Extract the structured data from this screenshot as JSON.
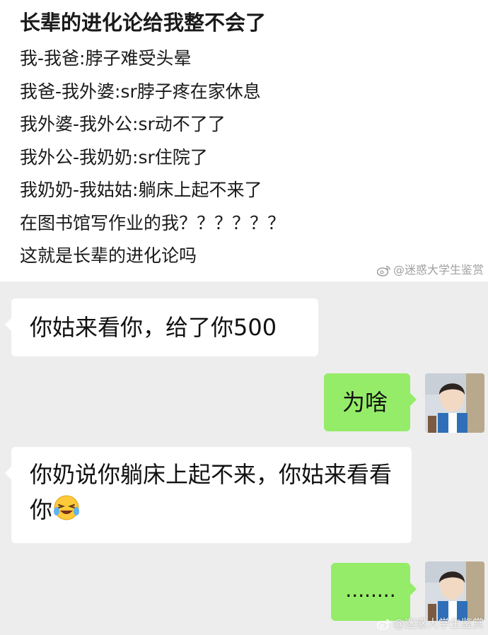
{
  "post": {
    "title": "长辈的进化论给我整不会了",
    "lines": [
      "我-我爸:脖子难受头晕",
      "我爸-我外婆:sr脖子疼在家休息",
      "我外婆-我外公:sr动不了了",
      "我外公-我奶奶:sr住院了",
      "我奶奶-我姑姑:躺床上起不来了",
      "在图书馆写作业的我？？？？？？",
      "这就是长辈的进化论吗"
    ]
  },
  "watermark": {
    "text": "@迷惑大学生鉴赏"
  },
  "chat": {
    "messages": [
      {
        "side": "in",
        "text": "你姑来看你，给了你500"
      },
      {
        "side": "out",
        "text": "为啥"
      },
      {
        "side": "in",
        "text": "你奶说你躺床上起不来，你姑来看看你",
        "emoji": "laughing-crying-face"
      },
      {
        "side": "out",
        "text": "........"
      }
    ]
  },
  "colors": {
    "chat_background": "#ededed",
    "incoming_bubble": "#ffffff",
    "outgoing_bubble": "#95ec69"
  }
}
